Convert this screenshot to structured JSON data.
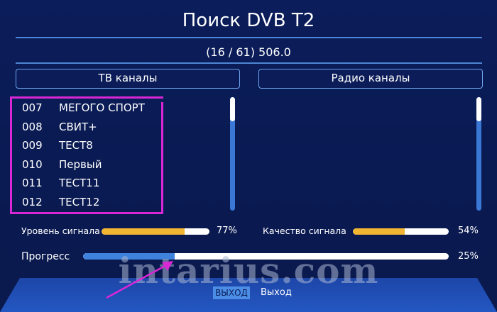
{
  "header": {
    "title": "Поиск DVB T2",
    "progress_text": "(16 / 61)  506.0"
  },
  "sections": {
    "tv_label": "ТВ каналы",
    "radio_label": "Радио каналы"
  },
  "tv_channels": [
    {
      "number": "007",
      "name": "МЕГОГО СПОРТ"
    },
    {
      "number": "008",
      "name": "СВИТ+"
    },
    {
      "number": "009",
      "name": "ТЕСТ8"
    },
    {
      "number": "010",
      "name": "Первый"
    },
    {
      "number": "011",
      "name": "ТЕСТ11"
    },
    {
      "number": "012",
      "name": "ТЕСТ12"
    }
  ],
  "meters": {
    "signal_level": {
      "label": "Уровень сигнала",
      "percent_text": "77%",
      "value": 77
    },
    "signal_quality": {
      "label": "Качество сигнала",
      "percent_text": "54%",
      "value": 54
    },
    "progress": {
      "label": "Прогресс",
      "percent_text": "25%",
      "value": 25
    }
  },
  "footer": {
    "exit_button": "ВЫХОД",
    "exit_label": "Выход"
  },
  "watermark": "intarius.com",
  "colors": {
    "accent_blue": "#4d86d6",
    "highlight": "#d927d6",
    "signal_bar": "#f1b531",
    "background": "#0a1a52"
  }
}
